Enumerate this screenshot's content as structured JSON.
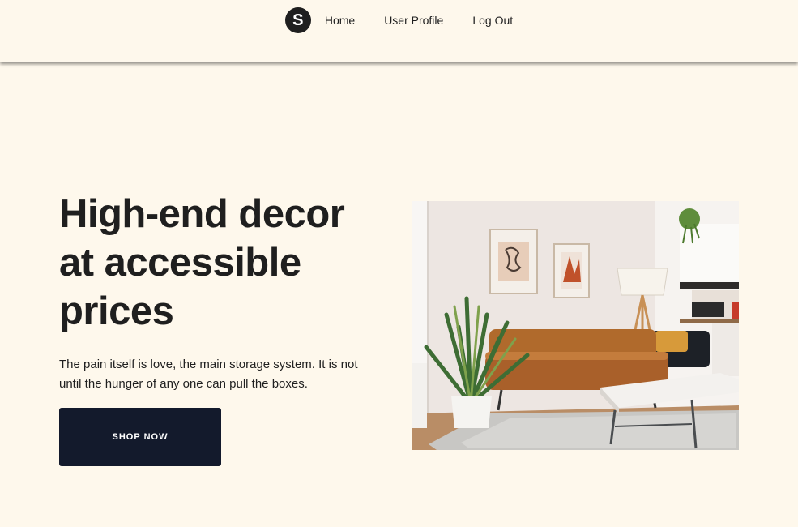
{
  "header": {
    "logo_letter": "S",
    "nav": [
      {
        "label": "Home"
      },
      {
        "label": "User Profile"
      },
      {
        "label": "Log Out"
      }
    ]
  },
  "hero": {
    "headline": "High-end decor at accessible prices",
    "subtext": "The pain itself is love, the main storage system. It is not until the hunger of any one can pull the boxes.",
    "cta_label": "SHOP NOW",
    "image_icon": "living-room-photo"
  },
  "colors": {
    "background": "#fef8ec",
    "text": "#1f1f1f",
    "button": "#131a2c",
    "button_text": "#ffffff"
  }
}
